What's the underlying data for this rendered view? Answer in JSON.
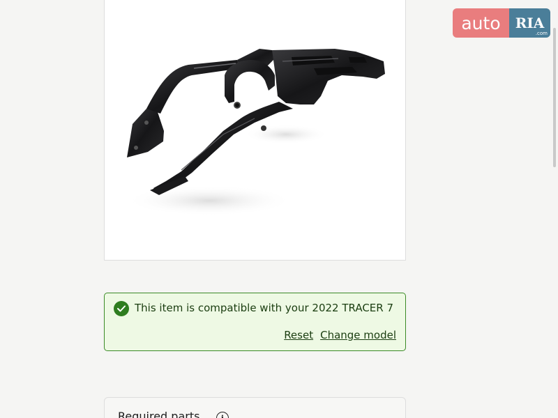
{
  "product": {
    "image_alt": "Black motorcycle rear rack carrier"
  },
  "compatibility": {
    "icon": "check-circle-icon",
    "prefix": "This item is compatible with your ",
    "model": "2022 TRACER 7",
    "reset_label": "Reset",
    "change_model_label": "Change model",
    "colors": {
      "border": "#3a8a25",
      "background": "#eef9e4",
      "icon": "#2e7d1f"
    }
  },
  "required_parts": {
    "title": "Required parts",
    "icon": "info-icon"
  },
  "watermark": {
    "left_text": "auto",
    "right_text": "RIA",
    "sub_text": ".com"
  }
}
